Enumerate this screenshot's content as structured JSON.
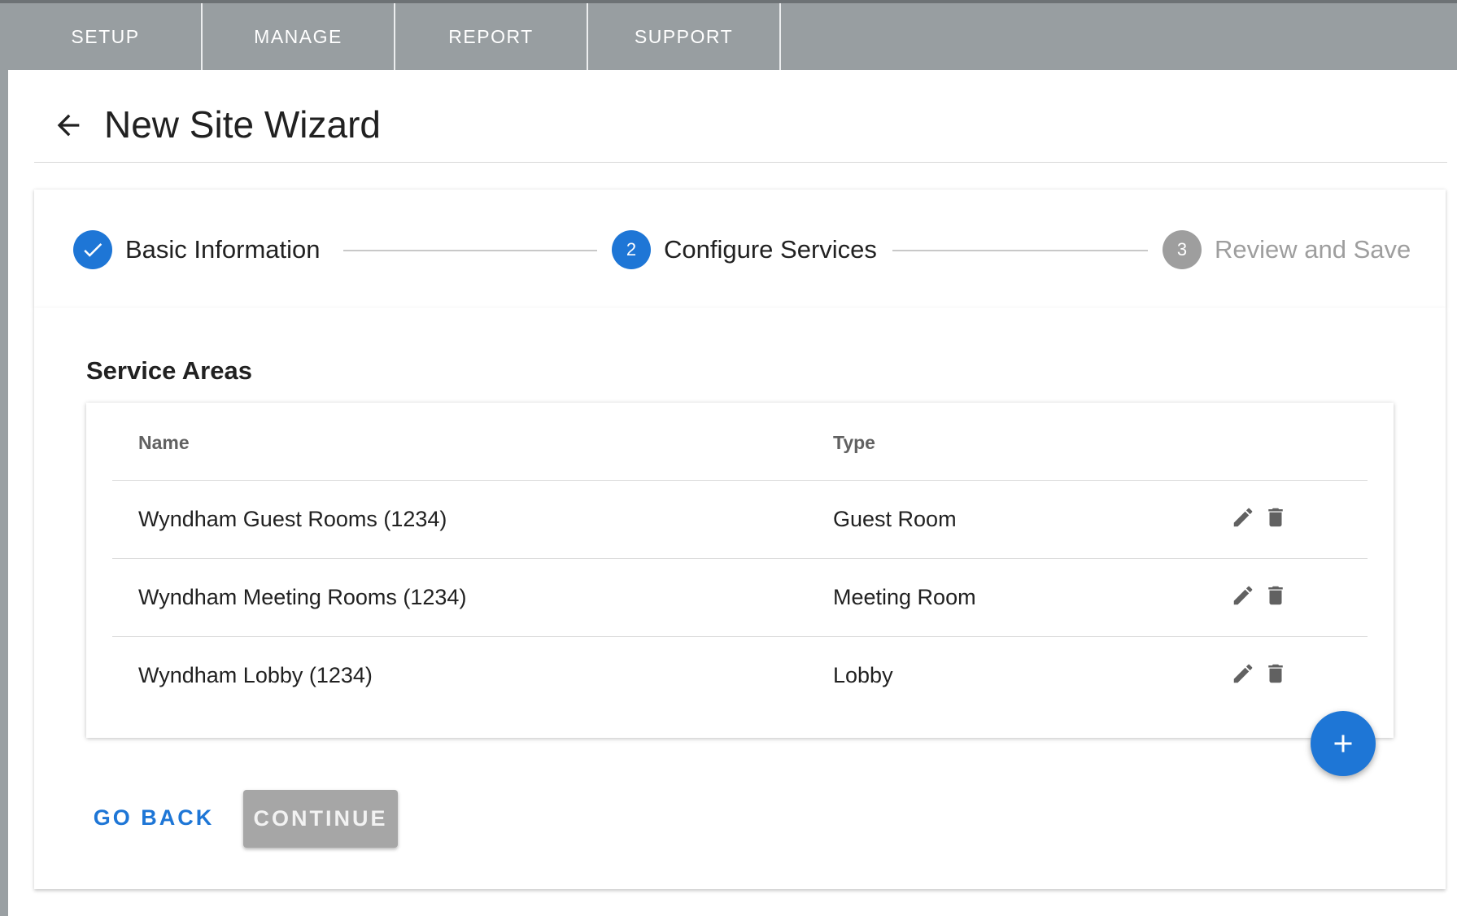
{
  "nav": {
    "tabs": [
      {
        "label": "SETUP"
      },
      {
        "label": "MANAGE"
      },
      {
        "label": "REPORT"
      },
      {
        "label": "SUPPORT"
      }
    ]
  },
  "header": {
    "title": "New Site Wizard",
    "back_icon": "arrow-left-icon"
  },
  "stepper": {
    "steps": [
      {
        "number": "1",
        "label": "Basic Information",
        "state": "complete"
      },
      {
        "number": "2",
        "label": "Configure Services",
        "state": "active"
      },
      {
        "number": "3",
        "label": "Review and Save",
        "state": "inactive"
      }
    ],
    "colors": {
      "active": "#1e76d6",
      "inactive": "#9e9e9e"
    }
  },
  "service_areas": {
    "title": "Service Areas",
    "columns": {
      "name": "Name",
      "type": "Type"
    },
    "rows": [
      {
        "name": "Wyndham Guest Rooms (1234)",
        "type": "Guest Room"
      },
      {
        "name": "Wyndham Meeting Rooms (1234)",
        "type": "Meeting Room"
      },
      {
        "name": "Wyndham Lobby (1234)",
        "type": "Lobby"
      }
    ],
    "row_icons": [
      "pencil-icon",
      "trash-icon"
    ]
  },
  "fab": {
    "icon": "plus-icon"
  },
  "actions": {
    "go_back": "GO BACK",
    "continue": "CONTINUE"
  }
}
